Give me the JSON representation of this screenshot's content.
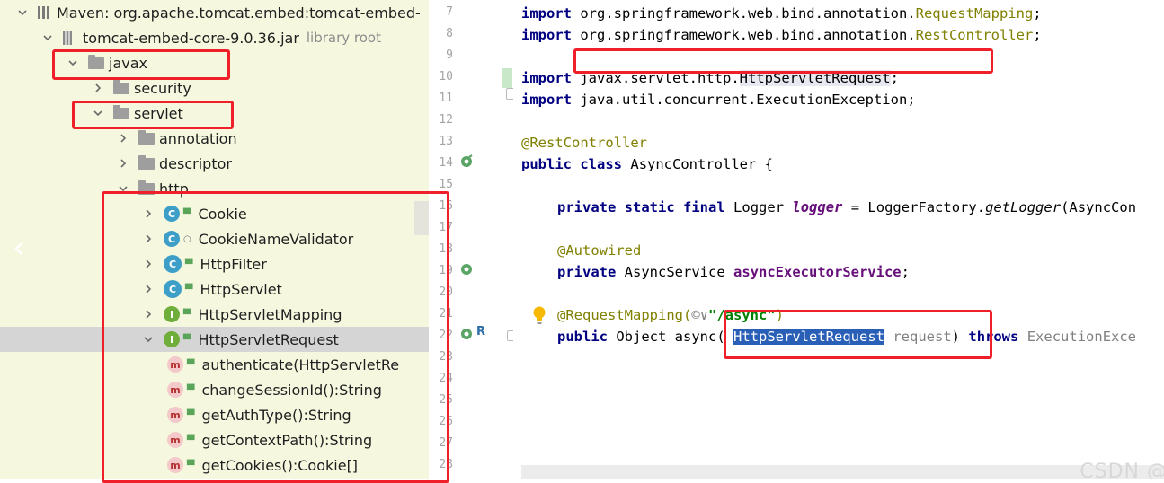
{
  "tree": {
    "rows": [
      {
        "label": "Maven: org.apache.tomcat.embed:tomcat-embed-",
        "sub": "",
        "icon": "maven-icon",
        "indent": 0,
        "expanded": true
      },
      {
        "label": "tomcat-embed-core-9.0.36.jar",
        "sub": "library root",
        "icon": "jar-icon",
        "indent": 1,
        "expanded": true
      },
      {
        "label": "javax",
        "sub": "",
        "icon": "folder-icon",
        "indent": 2,
        "expanded": true
      },
      {
        "label": "security",
        "sub": "",
        "icon": "folder-icon",
        "indent": 3,
        "expanded": false
      },
      {
        "label": "servlet",
        "sub": "",
        "icon": "folder-icon",
        "indent": 3,
        "expanded": true
      },
      {
        "label": "annotation",
        "sub": "",
        "icon": "folder-icon",
        "indent": 4,
        "expanded": false
      },
      {
        "label": "descriptor",
        "sub": "",
        "icon": "folder-icon",
        "indent": 4,
        "expanded": false
      },
      {
        "label": "http",
        "sub": "",
        "icon": "folder-icon",
        "indent": 4,
        "expanded": true
      },
      {
        "label": "Cookie",
        "sub": "",
        "icon": "class-icon",
        "indent": 5,
        "expanded": false
      },
      {
        "label": "CookieNameValidator",
        "sub": "",
        "icon": "class-icon",
        "indent": 5,
        "expanded": false
      },
      {
        "label": "HttpFilter",
        "sub": "",
        "icon": "abstract-class-icon",
        "indent": 5,
        "expanded": false
      },
      {
        "label": "HttpServlet",
        "sub": "",
        "icon": "abstract-class-icon",
        "indent": 5,
        "expanded": false
      },
      {
        "label": "HttpServletMapping",
        "sub": "",
        "icon": "interface-icon",
        "indent": 5,
        "expanded": false
      },
      {
        "label": "HttpServletRequest",
        "sub": "",
        "icon": "interface-icon",
        "indent": 5,
        "expanded": true
      },
      {
        "label": "authenticate(HttpServletRe",
        "sub": "",
        "icon": "method-icon",
        "indent": 6,
        "expanded": null
      },
      {
        "label": "changeSessionId():String",
        "sub": "",
        "icon": "method-icon",
        "indent": 6,
        "expanded": null
      },
      {
        "label": "getAuthType():String",
        "sub": "",
        "icon": "method-icon",
        "indent": 6,
        "expanded": null
      },
      {
        "label": "getContextPath():String",
        "sub": "",
        "icon": "method-icon",
        "indent": 6,
        "expanded": null
      },
      {
        "label": "getCookies():Cookie[]",
        "sub": "",
        "icon": "method-icon",
        "indent": 6,
        "expanded": null
      }
    ],
    "icon_letters": {
      "class": "C",
      "interface": "I",
      "method": "m"
    }
  },
  "gutter": {
    "line_numbers": [
      "7",
      "8",
      "9",
      "10",
      "11",
      "12",
      "13",
      "14",
      "15",
      "16",
      "17",
      "18",
      "19",
      "20",
      "21",
      "22",
      "23",
      "24",
      "25",
      "26",
      "27",
      "28"
    ],
    "line22_marker": "R"
  },
  "code": {
    "line7": {
      "kw": "import",
      "pkg": "org.springframework.web.bind.annotation.",
      "cls": "RequestMapping",
      "end": ";"
    },
    "line8": {
      "kw": "import",
      "pkg": "org.springframework.web.bind.annotation.",
      "cls": "RestController",
      "end": ";"
    },
    "line10": {
      "kw": "import",
      "pkg": "javax.servlet.http.",
      "cls": "HttpServletRequest",
      "end": ";"
    },
    "line11": {
      "kw": "import",
      "rest": "java.util.concurrent.ExecutionException;"
    },
    "line13": {
      "ann": "@RestController"
    },
    "line14": {
      "kw1": "public",
      "kw2": "class",
      "rest": "AsyncController {"
    },
    "line16": {
      "kw1": "private",
      "kw2": "static",
      "kw3": "final",
      "type": "Logger",
      "field": "logger",
      "eq": "=",
      "factory": "LoggerFactory.",
      "method": "getLogger",
      "arg": "(AsyncCon"
    },
    "line18": {
      "ann": "@Autowired"
    },
    "line19": {
      "kw": "private",
      "type": "AsyncService",
      "field": "asyncExecutorService",
      "end": ";"
    },
    "line21": {
      "ann": "@RequestMapping(",
      "hint": "©∨",
      "str": "\"/async\"",
      "end": ")"
    },
    "line22": {
      "kw": "public",
      "mid": "Object async(",
      "type": "HttpServletRequest",
      "param": "request",
      "close": ")",
      "throws": "throws",
      "exc": "ExecutionExce"
    }
  },
  "watermark": "CSDN @",
  "colors": {
    "tree_bg": "#f5f8df",
    "selected_row": "#d5d5d5",
    "redbox": "#f0202a",
    "selection": "#2a5fb8",
    "keyword": "#000080",
    "annotation": "#808000"
  }
}
